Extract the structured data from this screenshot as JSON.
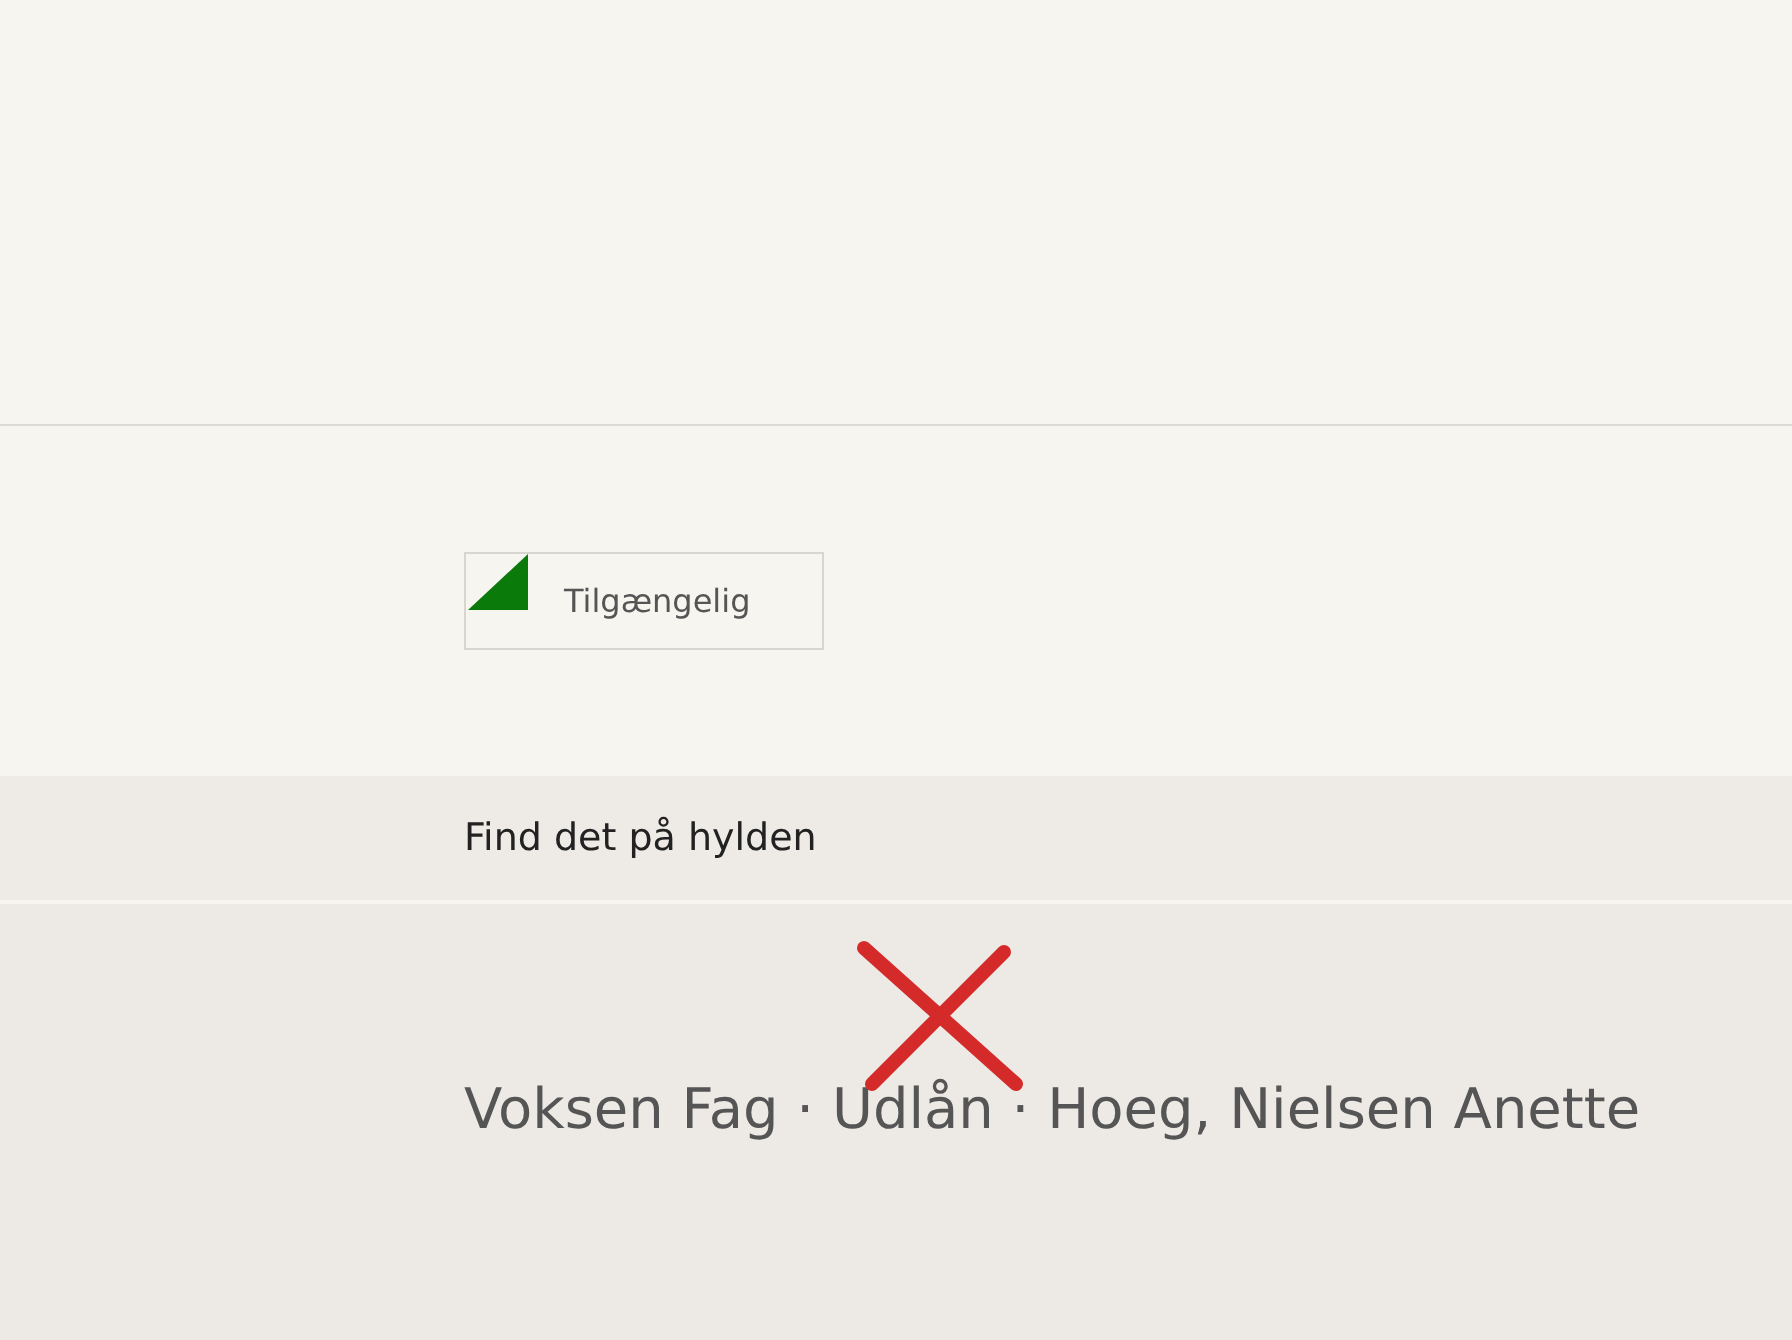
{
  "status": {
    "label": "Tilgængelig",
    "available": true
  },
  "shelf_section": {
    "title": "Find det på hylden"
  },
  "location": {
    "text": "Voksen Fag · Udlån · Hoeg, Nielsen Anette",
    "marked": true
  }
}
